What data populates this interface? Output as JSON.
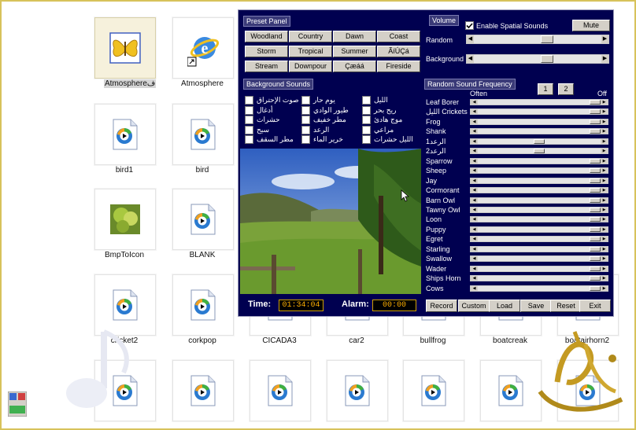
{
  "desktop": {
    "tiles": [
      {
        "label": "Atmosphereف",
        "kind": "butterfly",
        "highlight": true
      },
      {
        "label": "Atmosphere",
        "kind": "ie",
        "highlight": false
      },
      {
        "label": "bird1",
        "kind": "media",
        "highlight": false
      },
      {
        "label": "bird",
        "kind": "media",
        "highlight": false
      },
      {
        "label": "BmpToIcon",
        "kind": "tree",
        "highlight": false
      },
      {
        "label": "BLANK",
        "kind": "media",
        "highlight": false
      },
      {
        "label": "cricket2",
        "kind": "media",
        "highlight": false
      },
      {
        "label": "corkpop",
        "kind": "media",
        "highlight": false
      },
      {
        "label": "CICADA3",
        "kind": "media",
        "highlight": false
      },
      {
        "label": "car2",
        "kind": "media",
        "highlight": false
      },
      {
        "label": "bullfrog",
        "kind": "media",
        "highlight": false
      },
      {
        "label": "boatcreak",
        "kind": "media",
        "highlight": false
      },
      {
        "label": "boatairhorn2",
        "kind": "media",
        "highlight": false
      },
      {
        "label": "",
        "kind": "media",
        "highlight": false
      },
      {
        "label": "",
        "kind": "media",
        "highlight": false
      },
      {
        "label": "",
        "kind": "media",
        "highlight": false
      },
      {
        "label": "",
        "kind": "media",
        "highlight": false
      },
      {
        "label": "",
        "kind": "media",
        "highlight": false
      },
      {
        "label": "",
        "kind": "media",
        "highlight": false
      },
      {
        "label": "",
        "kind": "media",
        "highlight": false
      }
    ]
  },
  "panel": {
    "preset_title": "Preset Panel",
    "presets": [
      "Woodland",
      "Country",
      "Dawn",
      "Coast",
      "Storm",
      "Tropical",
      "Summer",
      "ÃíÚÇá",
      "Stream",
      "Downpour",
      "Çæáá",
      "Fireside"
    ],
    "volume_title": "Volume",
    "spatial_label": "Enable Spatial Sounds",
    "spatial_checked": true,
    "mute_label": "Mute",
    "random_label": "Random",
    "random_level": 0.58,
    "background_label": "Background",
    "background_level": 0.58,
    "bg_sounds_title": "Background Sounds",
    "bg_sounds": [
      [
        "صوت الإحتراق",
        "يوم حار",
        "الليل"
      ],
      [
        "أدغال",
        "طيور الوادي",
        "ريح بحر"
      ],
      [
        "حشرات",
        "مطر خفيف",
        "موج هادئ"
      ],
      [
        "سيح",
        "الرعد",
        "مراعي"
      ],
      [
        "مطر السقف",
        "خرير الماء",
        "الليل حشرات"
      ]
    ],
    "rsf_title": "Random Sound Frequency",
    "page_buttons": [
      "1",
      "2"
    ],
    "often_label": "Often",
    "off_label": "Off",
    "frequencies": [
      {
        "name": "Leaf Borer",
        "level": 0.0
      },
      {
        "name": "الليل Crickets",
        "level": 0.0
      },
      {
        "name": "Frog",
        "level": 0.0
      },
      {
        "name": "Shank",
        "level": 0.0
      },
      {
        "name": "الرعد1",
        "level": 0.5
      },
      {
        "name": "الرعد2",
        "level": 0.5
      },
      {
        "name": "Sparrow",
        "level": 0.0
      },
      {
        "name": "Sheep",
        "level": 0.0
      },
      {
        "name": "Jay",
        "level": 0.0
      },
      {
        "name": "Cormorant",
        "level": 0.0
      },
      {
        "name": "Barn Owl",
        "level": 0.0
      },
      {
        "name": "Tawny Owl",
        "level": 0.0
      },
      {
        "name": "Loon",
        "level": 0.0
      },
      {
        "name": "Puppy",
        "level": 0.0
      },
      {
        "name": "Egret",
        "level": 0.0
      },
      {
        "name": "Starling",
        "level": 0.0
      },
      {
        "name": "Swallow",
        "level": 0.0
      },
      {
        "name": "Wader",
        "level": 0.0
      },
      {
        "name": "Ships Horn",
        "level": 0.0
      },
      {
        "name": "Cows",
        "level": 0.0
      }
    ],
    "time_label": "Time:",
    "time_value": "01:34:04",
    "alarm_label": "Alarm:",
    "alarm_value": "00:00",
    "bottom_buttons": [
      "Record",
      "Custom",
      "Load",
      "Save",
      "Reset",
      "Exit"
    ]
  },
  "colors": {
    "panel_bg": "#000050",
    "frame": "#d7c25b",
    "time_text": "#ffb000"
  }
}
